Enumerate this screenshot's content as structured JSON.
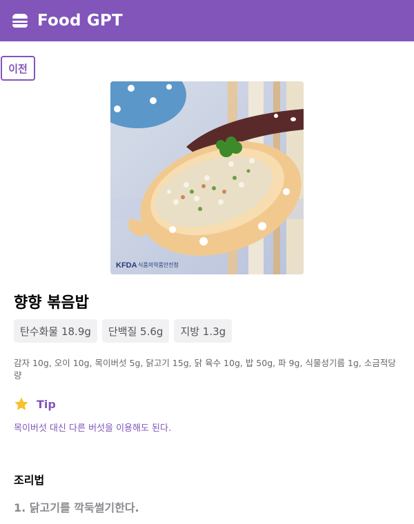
{
  "app": {
    "title": "Food GPT",
    "icon": "hamburger-icon"
  },
  "nav": {
    "back_label": "이전"
  },
  "recipe": {
    "name": "향향 볶음밥",
    "image_caption": "식품의약품안전청",
    "nutrition": [
      "탄수화물 18.9g",
      "단백질 5.6g",
      "지방 1.3g"
    ],
    "ingredients": "감자 10g, 오이 10g, 목이버섯 5g, 닭고기 15g, 닭 육수 10g, 밥 50g, 파 9g, 식물성기름 1g, 소금적당량",
    "tip_label": "Tip",
    "tip_icon": "star-icon",
    "tip_text": "목이버섯 대신 다른 버섯을 이용해도 된다.",
    "steps_heading": "조리법",
    "steps": [
      "1. 닭고기를 깍둑썰기한다."
    ]
  },
  "colors": {
    "accent": "#8155BA",
    "star": "#F7C12B",
    "chip_bg": "#F1F1F3"
  }
}
